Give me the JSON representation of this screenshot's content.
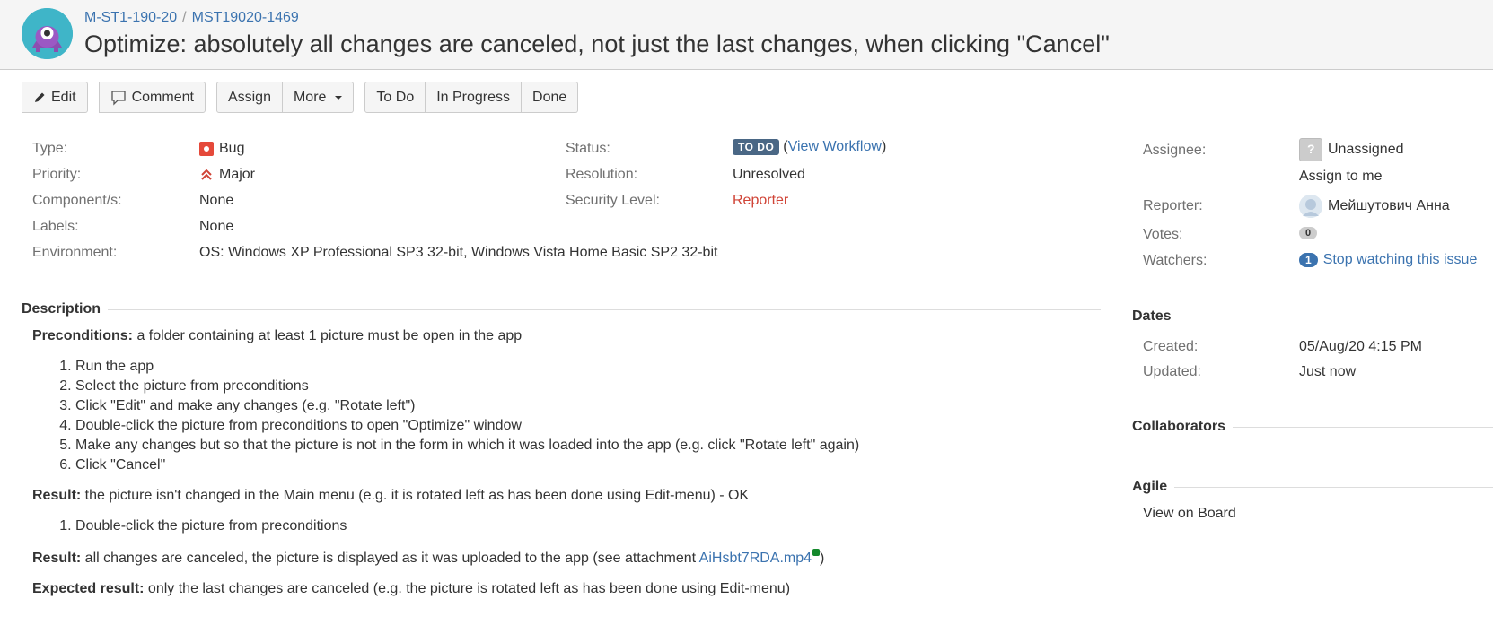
{
  "breadcrumb": {
    "project": "M-ST1-190-20",
    "separator": "/",
    "issue_key": "MST19020-1469"
  },
  "issue_title": "Optimize: absolutely all changes are canceled, not just the last changes, when clicking \"Cancel\"",
  "toolbar": {
    "edit": "Edit",
    "comment": "Comment",
    "assign": "Assign",
    "more": "More",
    "todo": "To Do",
    "in_progress": "In Progress",
    "done": "Done"
  },
  "details": {
    "type_label": "Type:",
    "type_value": "Bug",
    "priority_label": "Priority:",
    "priority_value": "Major",
    "components_label": "Component/s:",
    "components_value": "None",
    "labels_label": "Labels:",
    "labels_value": "None",
    "environment_label": "Environment:",
    "environment_value": "OS: Windows XP Professional SP3 32-bit, Windows Vista Home Basic SP2 32-bit",
    "status_label": "Status:",
    "status_value": "TO DO",
    "view_workflow_open": "(",
    "view_workflow": "View Workflow",
    "view_workflow_close": ")",
    "resolution_label": "Resolution:",
    "resolution_value": "Unresolved",
    "security_label": "Security Level:",
    "security_value": "Reporter"
  },
  "people": {
    "assignee_label": "Assignee:",
    "assignee_value": "Unassigned",
    "assign_to_me": "Assign to me",
    "reporter_label": "Reporter:",
    "reporter_value": "Мейшутович Анна",
    "votes_label": "Votes:",
    "votes_count": "0",
    "watchers_label": "Watchers:",
    "watchers_count": "1",
    "stop_watching": "Stop watching this issue"
  },
  "dates": {
    "heading": "Dates",
    "created_label": "Created:",
    "created_value": "05/Aug/20 4:15 PM",
    "updated_label": "Updated:",
    "updated_value": "Just now"
  },
  "collaborators": {
    "heading": "Collaborators"
  },
  "agile": {
    "heading": "Agile",
    "view_on_board": "View on Board"
  },
  "description": {
    "heading": "Description",
    "preconditions_label": "Preconditions:",
    "preconditions_text": " a folder containing at least 1 picture must be open in the app",
    "steps": [
      "Run the app",
      "Select the picture from preconditions",
      "Click \"Edit\" and make any changes (e.g. \"Rotate left\")",
      "Double-click the picture from preconditions to open \"Optimize\" window",
      "Make any changes but so that the picture is not in the form in which it was loaded into the app (e.g. click \"Rotate left\" again)",
      "Click \"Cancel\""
    ],
    "result1_label": "Result:",
    "result1_text": " the picture isn't changed in the Main menu (e.g. it is rotated left as has been done using Edit-menu) - OK",
    "steps2": [
      "Double-click the picture from preconditions"
    ],
    "result2_label": "Result:",
    "result2_text": " all changes are canceled, the picture is displayed as it was uploaded to the app (see attachment ",
    "attachment": "AiHsbt7RDA.mp4",
    "result2_close": ")",
    "expected_label": "Expected result:",
    "expected_text": " only the last changes are canceled (e.g. the picture is rotated left as has been done using Edit-menu)"
  },
  "colors": {
    "link": "#3b73af",
    "status_lozenge": "#4a6785",
    "bug": "#e5493a",
    "security": "#d04437"
  }
}
